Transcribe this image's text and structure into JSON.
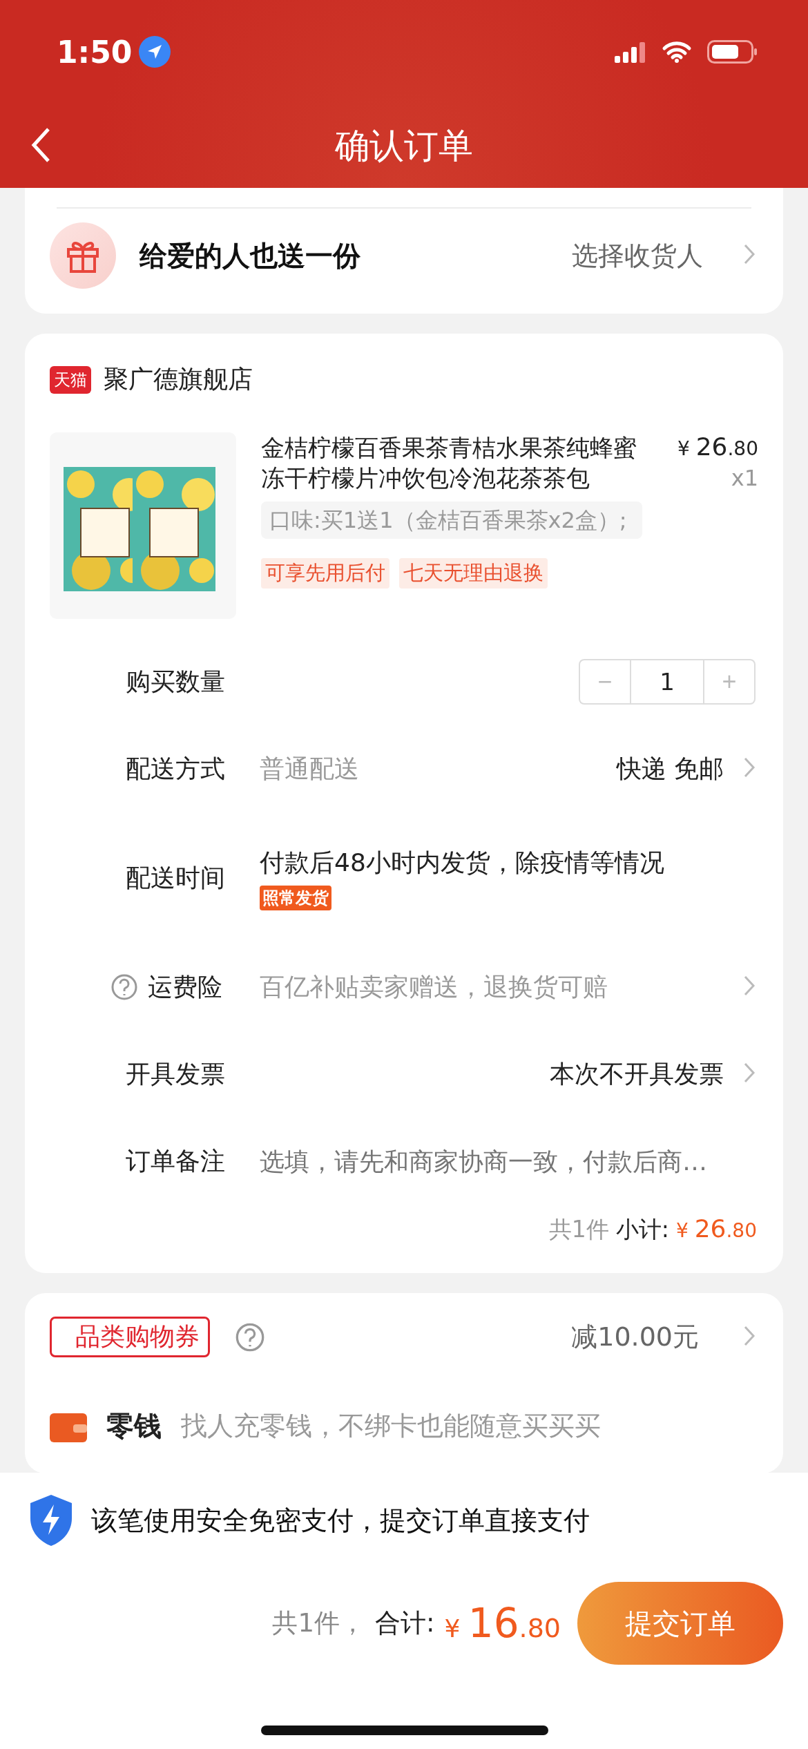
{
  "status_bar": {
    "time": "1:50"
  },
  "nav": {
    "title": "确认订单"
  },
  "gift": {
    "title": "给爱的人也送一份",
    "action": "选择收货人"
  },
  "store": {
    "badge": "天猫",
    "name": "聚广德旗舰店"
  },
  "product": {
    "title": "金桔柠檬百香果茶青桔水果茶纯蜂蜜冻干柠檬片冲饮包冷泡花茶茶包",
    "currency": "¥",
    "price_int": "26",
    "price_dec": ".80",
    "qty": "x1",
    "spec": "口味:买1送1（金桔百香果茶x2盒）;",
    "tags": [
      "可享先用后付",
      "七天无理由退换"
    ]
  },
  "rows": [
    {
      "kind": "stepper",
      "label": "购买数量",
      "minus": "−",
      "value": "1",
      "plus": "+"
    },
    {
      "kind": "split",
      "label": "配送方式",
      "value": "普通配送",
      "right": "快递 免邮",
      "arrow": true
    },
    {
      "kind": "time",
      "label": "配送时间",
      "value": "付款后48小时内发货，除疫情等情况",
      "badge": "照常发货"
    },
    {
      "kind": "help",
      "label": "运费险",
      "value": "百亿补贴卖家赠送，退换货可赔",
      "arrow": true
    },
    {
      "kind": "right",
      "label": "开具发票",
      "right": "本次不开具发票",
      "arrow": true
    },
    {
      "kind": "note",
      "label": "订单备注",
      "placeholder": "选填，请先和商家协商一致，付款后商…"
    }
  ],
  "subtotal": {
    "count": "共1件",
    "label": "小计:",
    "currency": "¥",
    "int": "26",
    "dec": ".80"
  },
  "coupon": {
    "label": "品类购物券",
    "value": "减10.00元"
  },
  "wallet": {
    "title": "零钱",
    "desc": "找人充零钱，不绑卡也能随意买买买"
  },
  "footer": {
    "notice": "该笔使用安全免密支付，提交订单直接支付",
    "count": "共1件，",
    "label": "合计:",
    "currency": "¥",
    "int": "16",
    "dec": ".80",
    "submit": "提交订单"
  }
}
